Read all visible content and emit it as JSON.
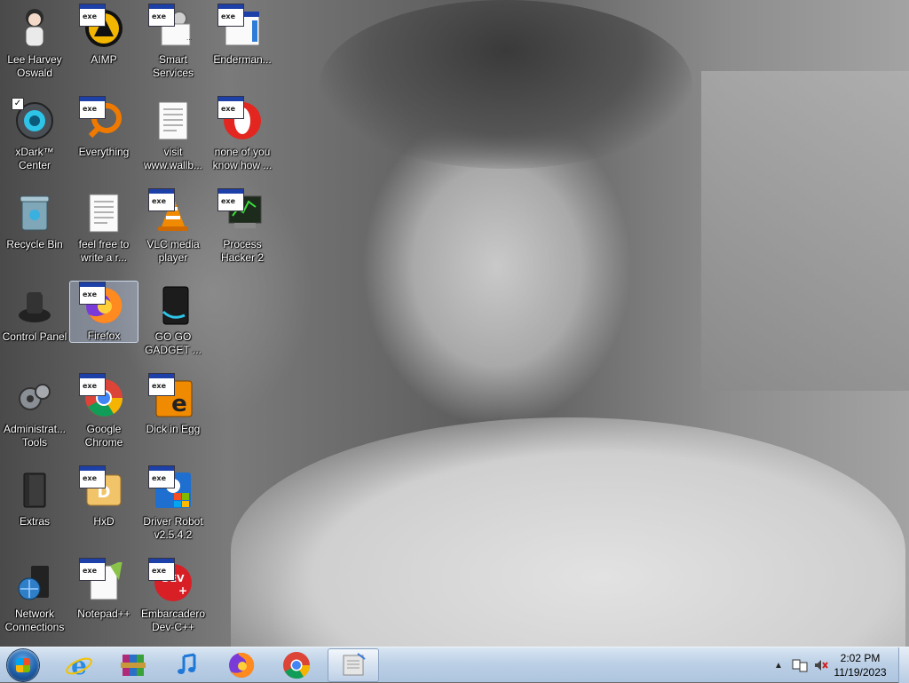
{
  "desktop_icons": [
    {
      "id": "lee-harvey-oswald",
      "lines": [
        "Lee Harvey",
        "Oswald"
      ],
      "icon": "anime-girl-icon"
    },
    {
      "id": "aimp",
      "lines": [
        "AIMP",
        ""
      ],
      "icon": "aimp-icon"
    },
    {
      "id": "smart-services",
      "lines": [
        "Smart",
        "Services"
      ],
      "icon": "gear-icon"
    },
    {
      "id": "enderman",
      "lines": [
        "Enderman...",
        ""
      ],
      "icon": "window-icon"
    },
    {
      "id": "xdark-center",
      "lines": [
        "xDark™",
        "Center"
      ],
      "icon": "xdark-icon"
    },
    {
      "id": "everything",
      "lines": [
        "Everything",
        ""
      ],
      "icon": "search-icon"
    },
    {
      "id": "visit-wallb",
      "lines": [
        "visit",
        "www.wallb..."
      ],
      "icon": "text-document-icon"
    },
    {
      "id": "none-of-you",
      "lines": [
        "none of you",
        "know how ..."
      ],
      "icon": "opera-icon"
    },
    {
      "id": "recycle-bin",
      "lines": [
        "Recycle Bin",
        ""
      ],
      "icon": "recycle-bin-icon"
    },
    {
      "id": "feel-free",
      "lines": [
        "feel free to",
        "write a r..."
      ],
      "icon": "text-document-icon"
    },
    {
      "id": "vlc",
      "lines": [
        "VLC media",
        "player"
      ],
      "icon": "vlc-cone-icon"
    },
    {
      "id": "process-hacker",
      "lines": [
        "Process",
        "Hacker 2"
      ],
      "icon": "process-hacker-icon"
    },
    {
      "id": "control-panel",
      "lines": [
        "Control Panel",
        ""
      ],
      "icon": "control-panel-icon"
    },
    {
      "id": "firefox",
      "lines": [
        "Firefox",
        ""
      ],
      "icon": "firefox-icon"
    },
    {
      "id": "go-go-gadget",
      "lines": [
        "GO GO",
        "GADGET ..."
      ],
      "icon": "gadget-icon"
    },
    {
      "id": "admin-tools",
      "lines": [
        "Administrat...",
        "Tools"
      ],
      "icon": "admin-tools-icon"
    },
    {
      "id": "google-chrome",
      "lines": [
        "Google",
        "Chrome"
      ],
      "icon": "chrome-icon"
    },
    {
      "id": "dick-in-egg",
      "lines": [
        "Dick in Egg",
        ""
      ],
      "icon": "egg-icon"
    },
    {
      "id": "extras",
      "lines": [
        "Extras",
        ""
      ],
      "icon": "folder-icon"
    },
    {
      "id": "hxd",
      "lines": [
        "HxD",
        ""
      ],
      "icon": "hxd-icon"
    },
    {
      "id": "driver-robot",
      "lines": [
        "Driver Robot",
        "v2.5.4.2"
      ],
      "icon": "driver-robot-icon"
    },
    {
      "id": "network-connections",
      "lines": [
        "Network",
        "Connections"
      ],
      "icon": "network-icon"
    },
    {
      "id": "notepadpp",
      "lines": [
        "Notepad++",
        ""
      ],
      "icon": "notepad-plus-icon"
    },
    {
      "id": "embarcadero",
      "lines": [
        "Embarcadero",
        "Dev-C++"
      ],
      "icon": "devcpp-icon"
    }
  ],
  "taskbar": {
    "pinned": [
      {
        "id": "ie",
        "icon": "internet-explorer-icon"
      },
      {
        "id": "winrar",
        "icon": "winrar-icon"
      },
      {
        "id": "music",
        "icon": "music-note-icon"
      },
      {
        "id": "firefox",
        "icon": "firefox-icon"
      },
      {
        "id": "chrome",
        "icon": "chrome-icon"
      },
      {
        "id": "active-app",
        "icon": "notepad-icon"
      }
    ],
    "tray": {
      "time": "2:02 PM",
      "date": "11/19/2023"
    }
  },
  "colors": {
    "taskbar_top": "#d9e6f3",
    "taskbar_bottom": "#aec5df",
    "label_text": "#ffffff",
    "selection": "#c8dcff"
  }
}
